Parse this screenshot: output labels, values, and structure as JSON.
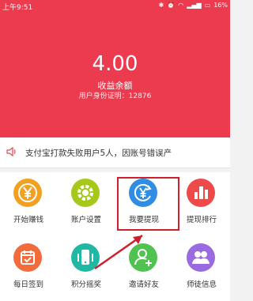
{
  "status_bar": {
    "time": "上午9:51",
    "battery": "16%",
    "icons": [
      "bluetooth-icon",
      "alarm-icon",
      "wifi-icon",
      "signal-icon",
      "battery-icon"
    ]
  },
  "hero": {
    "amount": "4.00",
    "label": "收益余额",
    "user_id": "用户身份证明：12876"
  },
  "notice": {
    "text": "支付宝打款失败用户5人，因账号错误产"
  },
  "menu": {
    "items": [
      {
        "label": "开始赚钱",
        "icon": "yen-coin-icon",
        "color": "#f2a01f"
      },
      {
        "label": "账户设置",
        "icon": "gear-icon",
        "color": "#a5c81a"
      },
      {
        "label": "我要提现",
        "icon": "withdraw-yen-icon",
        "color": "#2f8de4"
      },
      {
        "label": "提现排行",
        "icon": "bar-chart-icon",
        "color": "#ef4a4a"
      },
      {
        "label": "每日签到",
        "icon": "calendar-check-icon",
        "color": "#f26b3a"
      },
      {
        "label": "积分摇奖",
        "icon": "phone-shake-icon",
        "color": "#1fb8a3"
      },
      {
        "label": "邀请好友",
        "icon": "add-friend-icon",
        "color": "#4fc24f"
      },
      {
        "label": "师徒信息",
        "icon": "people-icon",
        "color": "#9a6ae0"
      }
    ]
  },
  "colors": {
    "brand_red": "#ec3b4e",
    "highlight_red": "#d01f2c"
  }
}
